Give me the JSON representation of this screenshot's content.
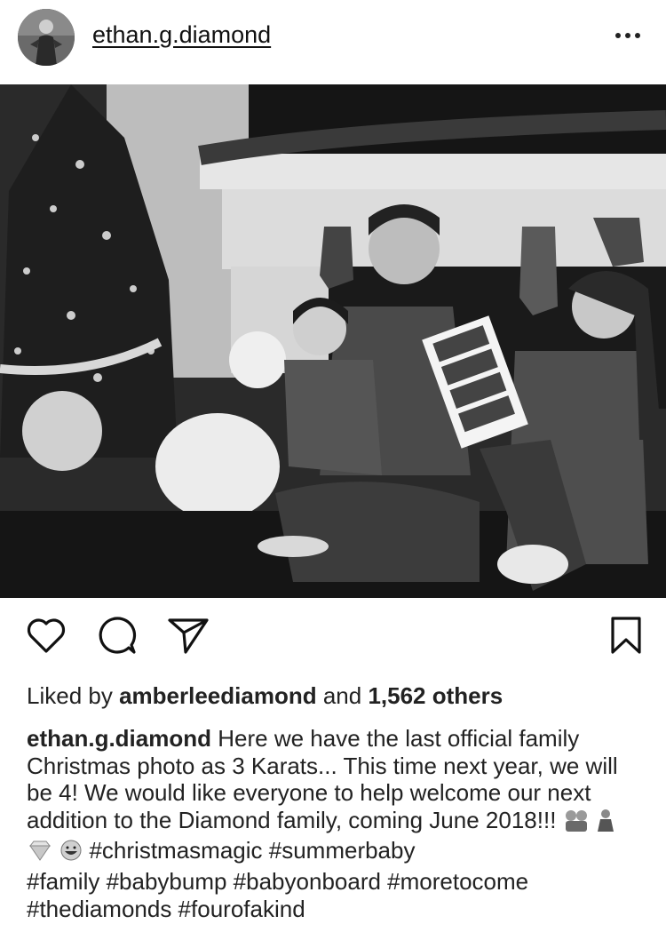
{
  "post": {
    "username": "ethan.g.diamond",
    "more_label": "•••"
  },
  "likes": {
    "prefix": "Liked by",
    "liker": "amberleediamond",
    "middle": "and",
    "count": "1,562 others"
  },
  "caption": {
    "username": "ethan.g.diamond",
    "text": "Here we have the last official family Christmas photo as 3 Karats... This time next year, we will be 4! We would like everyone to help welcome our next addition to the Diamond family, coming June 2018!!!",
    "emoji": [
      "family-emoji",
      "pregnant-woman-emoji",
      "gem-emoji",
      "grinning-face-emoji"
    ],
    "hashtags_line1": "#christmasmagic #summerbaby",
    "hashtags_line2": "#family #babybump #babyonboard #moretocome",
    "hashtags_line3": "#thediamonds #fourofakind"
  },
  "icons": [
    "more-icon",
    "heart-icon",
    "comment-icon",
    "share-icon",
    "bookmark-icon"
  ]
}
